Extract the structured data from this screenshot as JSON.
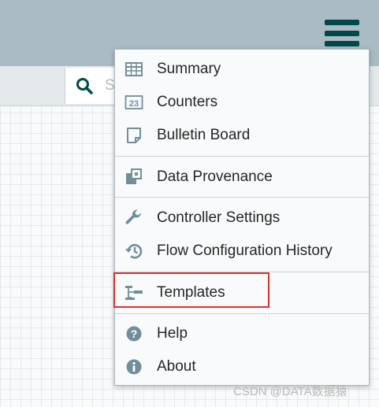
{
  "header": {
    "menu_icon": "hamburger-menu-icon"
  },
  "search": {
    "placeholder": "Search",
    "icon": "search-icon"
  },
  "menu": {
    "items": [
      {
        "label": "Summary",
        "icon": "table-icon"
      },
      {
        "label": "Counters",
        "icon": "counter-icon"
      },
      {
        "label": "Bulletin Board",
        "icon": "sticky-note-icon"
      },
      {
        "label": "Data Provenance",
        "icon": "provenance-icon"
      },
      {
        "label": "Controller Settings",
        "icon": "wrench-icon"
      },
      {
        "label": "Flow Configuration History",
        "icon": "history-icon"
      },
      {
        "label": "Templates",
        "icon": "templates-icon"
      },
      {
        "label": "Help",
        "icon": "question-circle-icon"
      },
      {
        "label": "About",
        "icon": "info-circle-icon"
      }
    ],
    "highlighted_item": "Templates"
  },
  "colors": {
    "header_bg": "#aabbc3",
    "accent": "#004849",
    "icon_gray": "#728e9b",
    "highlight": "#e0302e"
  },
  "watermark": "CSDN @DATA数据猿"
}
